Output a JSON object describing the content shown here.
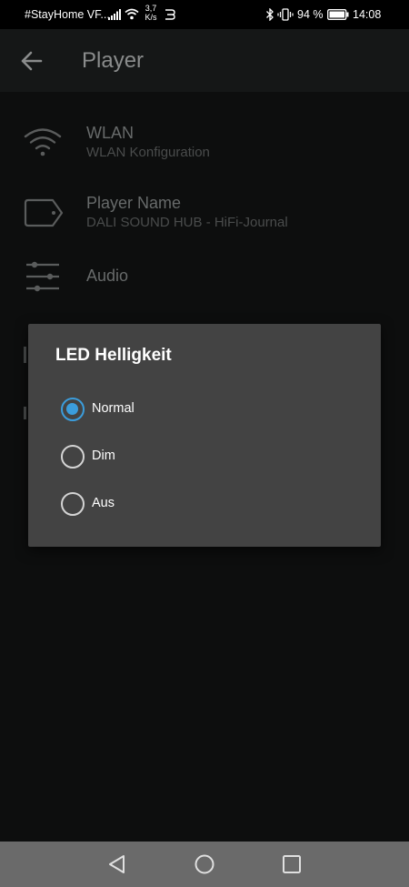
{
  "status_bar": {
    "carrier": "#StayHome VF...",
    "speed_value": "3,7",
    "speed_unit": "K/s",
    "battery_percent": "94 %",
    "time": "14:08"
  },
  "app_bar": {
    "title": "Player"
  },
  "settings": {
    "items": [
      {
        "title": "WLAN",
        "subtitle": "WLAN Konfiguration",
        "icon": "wifi-icon"
      },
      {
        "title": "Player Name",
        "subtitle": "DALI SOUND HUB - HiFi-Journal",
        "icon": "tag-icon"
      },
      {
        "title": "Audio",
        "subtitle": "",
        "icon": "sliders-icon"
      }
    ]
  },
  "dialog": {
    "title": "LED Helligkeit",
    "options": [
      {
        "label": "Normal",
        "selected": true
      },
      {
        "label": "Dim",
        "selected": false
      },
      {
        "label": "Aus",
        "selected": false
      }
    ]
  },
  "colors": {
    "accent": "#3b9ddc",
    "dialog_bg": "#434343",
    "nav_bar": "#6a6a6a"
  }
}
